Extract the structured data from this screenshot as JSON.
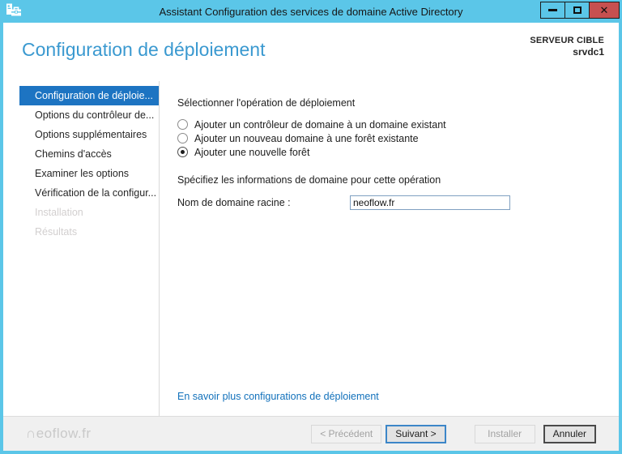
{
  "window": {
    "title": "Assistant Configuration des services de domaine Active Directory"
  },
  "icons": {
    "app_icon": "server-with-toolbox",
    "minimize_icon": "horizontal-bar",
    "maximize_icon": "square-outline",
    "close_glyph": "✕"
  },
  "header": {
    "title": "Configuration de déploiement",
    "target_server_label": "SERVEUR CIBLE",
    "target_server_name": "srvdc1"
  },
  "sidebar": {
    "items": [
      {
        "label": "Configuration de déploie...",
        "state": "selected"
      },
      {
        "label": "Options du contrôleur de...",
        "state": "enabled"
      },
      {
        "label": "Options supplémentaires",
        "state": "enabled"
      },
      {
        "label": "Chemins d'accès",
        "state": "enabled"
      },
      {
        "label": "Examiner les options",
        "state": "enabled"
      },
      {
        "label": "Vérification de la configur...",
        "state": "enabled"
      },
      {
        "label": "Installation",
        "state": "disabled"
      },
      {
        "label": "Résultats",
        "state": "disabled"
      }
    ]
  },
  "main": {
    "select_operation_label": "Sélectionner l'opération de déploiement",
    "operations": [
      {
        "label": "Ajouter un contrôleur de domaine à un domaine existant",
        "selected": false
      },
      {
        "label": "Ajouter un nouveau domaine à une forêt existante",
        "selected": false
      },
      {
        "label": "Ajouter une nouvelle forêt",
        "selected": true
      }
    ],
    "specify_info_label": "Spécifiez les informations de domaine pour cette opération",
    "domain_field": {
      "label": "Nom de domaine racine :",
      "value": "neoflow.fr"
    },
    "learn_more_link": "En savoir plus configurations de déploiement"
  },
  "footer": {
    "watermark": "∩eoflow.fr",
    "buttons": [
      {
        "label": "< Précédent",
        "state": "disabled"
      },
      {
        "label": "Suivant >",
        "state": "default"
      },
      {
        "label": "Installer",
        "state": "disabled"
      },
      {
        "label": "Annuler",
        "state": "enabled"
      }
    ]
  },
  "colors": {
    "titlebar": "#5bc6e8",
    "sidebar_selected": "#1d74c2",
    "heading": "#3a99d0",
    "link": "#1271bb",
    "close_button": "#c75050"
  }
}
